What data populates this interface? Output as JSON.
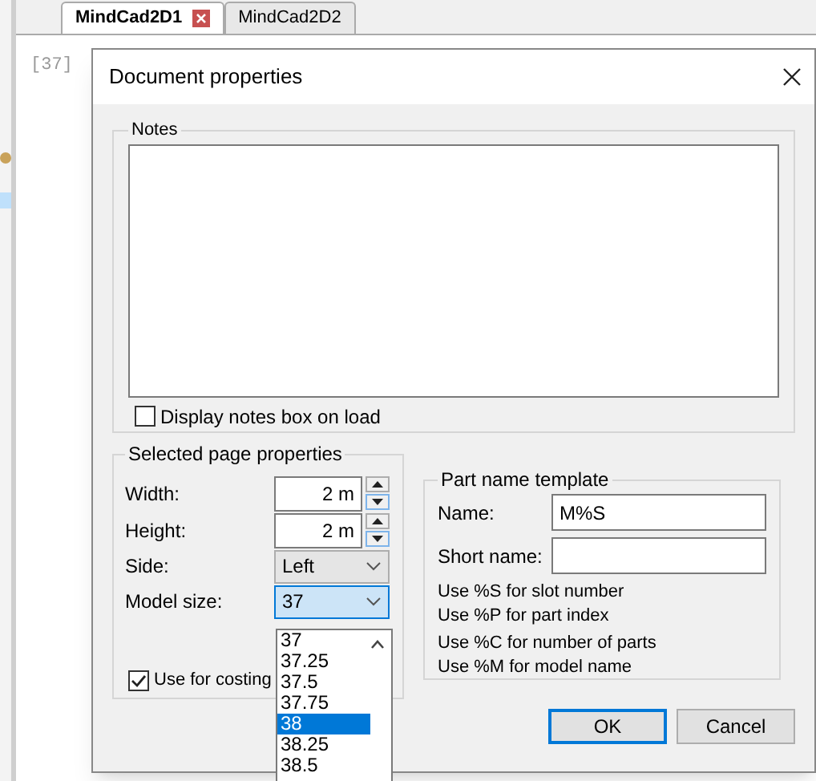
{
  "tabs": [
    {
      "label": "MindCad2D1",
      "selected": true,
      "closable": true
    },
    {
      "label": "MindCad2D2",
      "selected": false,
      "closable": false
    }
  ],
  "editor": {
    "line_label": "[37]"
  },
  "dialog": {
    "title": "Document properties",
    "notes": {
      "legend": "Notes",
      "display_on_load": {
        "label": "Display notes box on load",
        "checked": false
      }
    },
    "page_properties": {
      "legend": "Selected page properties",
      "fields": [
        {
          "kind": "spin",
          "label": "Width:",
          "value": "2 m"
        },
        {
          "kind": "spin",
          "label": "Height:",
          "value": "2 m"
        },
        {
          "kind": "select",
          "label": "Side:",
          "value": "Left",
          "focused": false
        },
        {
          "kind": "select",
          "label": "Model size:",
          "value": "37",
          "focused": true
        }
      ],
      "use_for_costing": {
        "label": "Use for costing",
        "checked": true
      }
    },
    "model_size_list": [
      {
        "label": "37",
        "selected": false
      },
      {
        "label": "37.25",
        "selected": false
      },
      {
        "label": "37.5",
        "selected": false
      },
      {
        "label": "37.75",
        "selected": false
      },
      {
        "label": "38",
        "selected": true
      },
      {
        "label": "38.25",
        "selected": false
      },
      {
        "label": "38.5",
        "selected": false
      }
    ],
    "part_name_template": {
      "legend": "Part name template",
      "fields": [
        {
          "label": "Name:",
          "value": "M%S"
        },
        {
          "label": "Short name:"
        }
      ],
      "hints": [
        "Use %S for slot number",
        "Use %P for part index",
        "Use %C for number of parts",
        "Use %M for model name"
      ]
    },
    "buttons": [
      {
        "label": "OK",
        "default": true
      },
      {
        "label": "Cancel",
        "default": false
      }
    ]
  }
}
